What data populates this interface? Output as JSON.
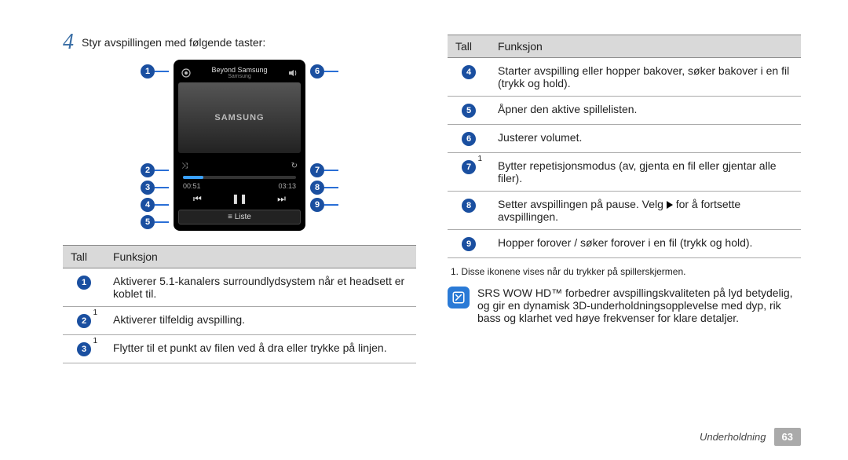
{
  "step": {
    "number": "4",
    "text": "Styr avspillingen med følgende taster:"
  },
  "phone": {
    "top_title": "Beyond Samsung",
    "top_sub": "Samsung",
    "album": "SAMSUNG",
    "time_left": "00:51",
    "time_right": "03:13",
    "list_label": "Liste"
  },
  "callouts_left": [
    "1",
    "2",
    "3",
    "4",
    "5"
  ],
  "callouts_right": [
    "6",
    "7",
    "8",
    "9"
  ],
  "table_left": {
    "head_num": "Tall",
    "head_func": "Funksjon",
    "rows": [
      {
        "n": "1",
        "sup": "",
        "f": "Aktiverer 5.1-kanalers surroundlydsystem når et headsett er koblet til."
      },
      {
        "n": "2",
        "sup": "1",
        "f": "Aktiverer tilfeldig avspilling."
      },
      {
        "n": "3",
        "sup": "1",
        "f": "Flytter til et punkt av filen ved å dra eller trykke på linjen."
      }
    ]
  },
  "table_right": {
    "head_num": "Tall",
    "head_func": "Funksjon",
    "rows": [
      {
        "n": "4",
        "sup": "",
        "f": "Starter avspilling eller hopper bakover, søker bakover i en fil (trykk og hold)."
      },
      {
        "n": "5",
        "sup": "",
        "f": "Åpner den aktive spillelisten."
      },
      {
        "n": "6",
        "sup": "",
        "f": "Justerer volumet."
      },
      {
        "n": "7",
        "sup": "1",
        "f": "Bytter repetisjonsmodus (av, gjenta en fil eller gjentar alle filer)."
      },
      {
        "n": "8",
        "sup": "",
        "f": "Setter avspillingen på pause. Velg ▶ for å fortsette avspillingen."
      },
      {
        "n": "9",
        "sup": "",
        "f": "Hopper forover / søker forover i en fil (trykk og hold)."
      }
    ]
  },
  "footnote": "1. Disse ikonene vises når du trykker på spillerskjermen.",
  "note": "SRS WOW HD™ forbedrer avspillingskvaliteten på lyd betydelig, og gir en dynamisk 3D-underholdningsopplevelse med dyp, rik bass og klarhet ved høye frekvenser for klare detaljer.",
  "footer": {
    "section": "Underholdning",
    "page": "63"
  }
}
